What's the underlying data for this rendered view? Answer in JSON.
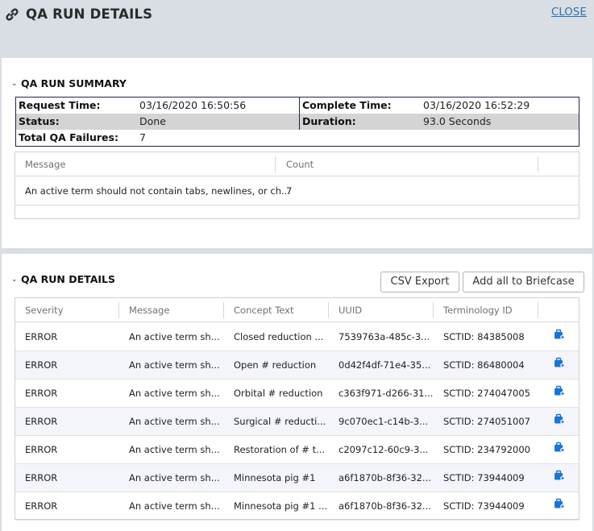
{
  "header": {
    "title": "QA RUN DETAILS",
    "close_label": "CLOSE"
  },
  "summary": {
    "section_title": "QA RUN SUMMARY",
    "request_time_label": "Request Time:",
    "request_time": "03/16/2020 16:50:56",
    "complete_time_label": "Complete Time:",
    "complete_time": "03/16/2020 16:52:29",
    "status_label": "Status:",
    "status": "Done",
    "duration_label": "Duration:",
    "duration": "93.0 Seconds",
    "failures_label": "Total QA Failures:",
    "failures": "7",
    "grid": {
      "col_message": "Message",
      "col_count": "Count",
      "rows": [
        {
          "message": "An active term should not contain tabs, newlines, or ch...",
          "count": "7"
        }
      ]
    }
  },
  "details": {
    "section_title": "QA RUN DETAILS",
    "csv_label": "CSV Export",
    "briefcase_label": "Add all to Briefcase",
    "columns": {
      "severity": "Severity",
      "message": "Message",
      "concept": "Concept Text",
      "uuid": "UUID",
      "terminology": "Terminology ID"
    },
    "rows": [
      {
        "severity": "ERROR",
        "message": "An active term sh...",
        "concept": "Closed reduction ...",
        "uuid": "7539763a-485c-3...",
        "terminology": "SCTID: 84385008"
      },
      {
        "severity": "ERROR",
        "message": "An active term sh...",
        "concept": "Open # reduction",
        "uuid": "0d42f4df-71e4-35...",
        "terminology": "SCTID: 86480004"
      },
      {
        "severity": "ERROR",
        "message": "An active term sh...",
        "concept": "Orbital # reduction",
        "uuid": "c363f971-d266-31...",
        "terminology": "SCTID: 274047005"
      },
      {
        "severity": "ERROR",
        "message": "An active term sh...",
        "concept": "Surgical # reducti...",
        "uuid": "9c070ec1-c14b-3...",
        "terminology": "SCTID: 274051007"
      },
      {
        "severity": "ERROR",
        "message": "An active term sh...",
        "concept": "Restoration of # t...",
        "uuid": "c2097c12-60c9-3...",
        "terminology": "SCTID: 234792000"
      },
      {
        "severity": "ERROR",
        "message": "An active term sh...",
        "concept": "Minnesota pig #1",
        "uuid": "a6f1870b-8f36-32...",
        "terminology": "SCTID: 73944009"
      },
      {
        "severity": "ERROR",
        "message": "An active term sh...",
        "concept": "Minnesota pig #1 ...",
        "uuid": "a6f1870b-8f36-32...",
        "terminology": "SCTID: 73944009"
      }
    ]
  },
  "icons": {
    "header": "link-icon",
    "row_action": "briefcase-add-icon",
    "collapse": "chevron-down-icon"
  },
  "colors": {
    "background": "#d9dee5",
    "link": "#2c6fb0",
    "summary_border": "#20264a",
    "status_row": "#d4d4d4",
    "alt_row": "#f4f5fa",
    "briefcase_icon": "#1a73d9"
  }
}
